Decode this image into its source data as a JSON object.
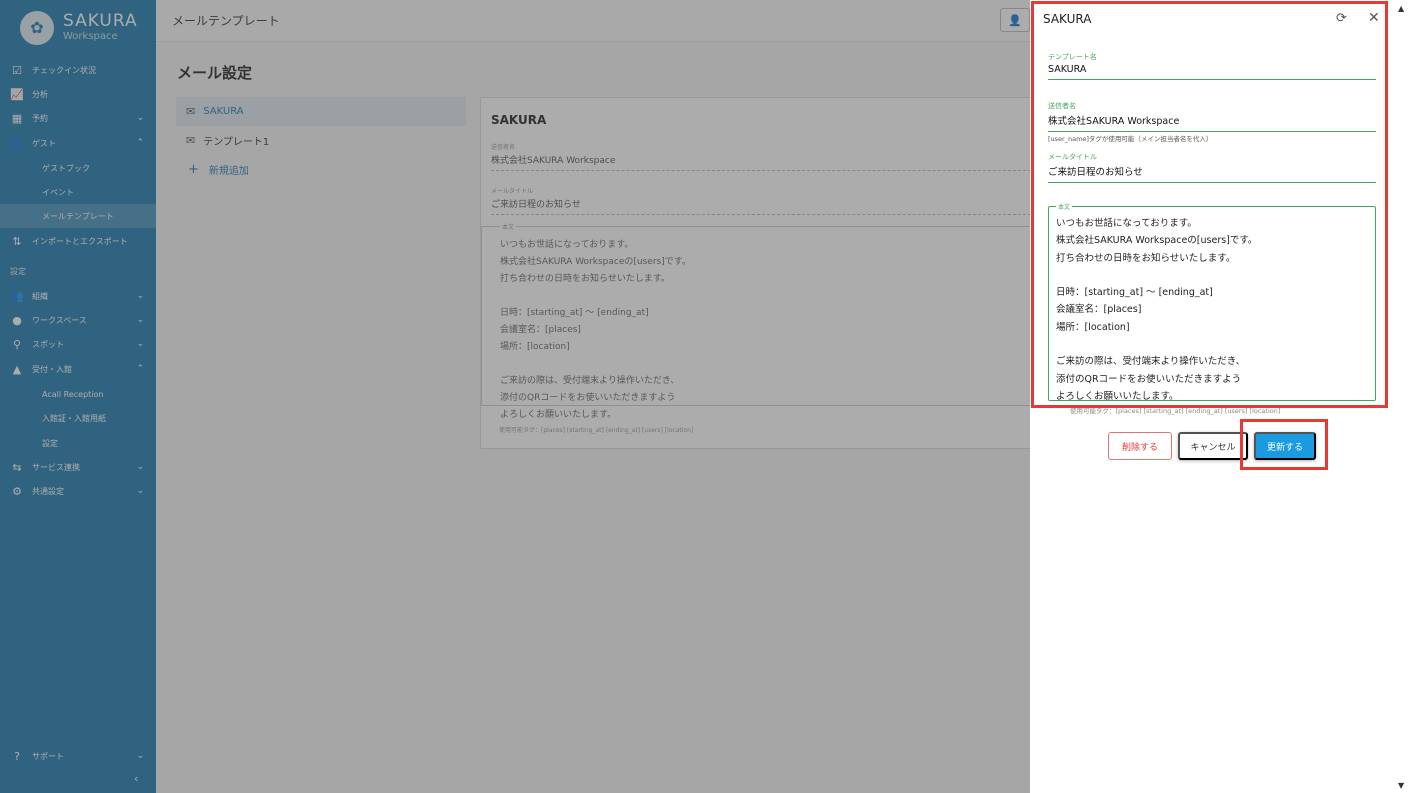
{
  "sidebar": {
    "brand": "SAKURA",
    "brand_sub": "Workspace",
    "items": [
      {
        "label": "チェックイン状況",
        "icon": "checkbox-icon"
      },
      {
        "label": "分析",
        "icon": "chart-line-icon"
      },
      {
        "label": "予約",
        "icon": "calendar-icon"
      },
      {
        "label": "ゲスト",
        "icon": "person-icon"
      },
      {
        "label": "インポートとエクスポート",
        "icon": "import-export-icon"
      },
      {
        "label": "組織",
        "icon": "group-icon"
      },
      {
        "label": "ワークスペース",
        "icon": "location-pin-icon"
      },
      {
        "label": "スポット",
        "icon": "spot-pin-icon"
      },
      {
        "label": "受付・入館",
        "icon": "reception-icon"
      },
      {
        "label": "サービス連携",
        "icon": "service-icon"
      },
      {
        "label": "共通設定",
        "icon": "gears-icon"
      },
      {
        "label": "サポート",
        "icon": "help-icon"
      }
    ],
    "guest_sub": [
      "ゲストブック",
      "イベント",
      "メールテンプレート"
    ],
    "reception_sub": [
      "Acall Reception",
      "入館証・入館用紙",
      "設定"
    ],
    "section_label": "設定"
  },
  "topbar": {
    "title": "メールテンプレート"
  },
  "main": {
    "page_title": "メール設定",
    "templates": [
      "SAKURA",
      "テンプレート1"
    ],
    "add_label": "新規追加",
    "detail": {
      "title": "SAKURA",
      "sender_label": "送信者名",
      "sender_value": "株式会社SAKURA Workspace",
      "subject_label": "メールタイトル",
      "subject_value": "ご来訪日程のお知らせ",
      "body_label": "本文",
      "body": "いつもお世話になっております。\n株式会社SAKURA Workspaceの[users]です。\n打ち合わせの日時をお知らせいたします。\n\n日時：[starting_at] 〜 [ending_at]\n会議室名：[places]\n場所：[location]\n\nご来訪の際は、受付端末より操作いただき、\n添付のQRコードをお使いいただきますよう\nよろしくお願いいたします。",
      "tags": "使用可能タグ：[places] [starting_at] [ending_at] [users] [location]"
    }
  },
  "drawer": {
    "title": "SAKURA",
    "template_name_label": "テンプレート名",
    "template_name_value": "SAKURA",
    "sender_label": "送信者名",
    "sender_value": "株式会社SAKURA Workspace",
    "sender_helper": "[user_name]タグが使用可能（メイン担当者名を代入）",
    "subject_label": "メールタイトル",
    "subject_value": "ご来訪日程のお知らせ",
    "body_label": "本文",
    "body": "いつもお世話になっております。\n株式会社SAKURA Workspaceの[users]です。\n打ち合わせの日時をお知らせいたします。\n\n日時：[starting_at] 〜 [ending_at]\n会議室名：[places]\n場所：[location]\n\nご来訪の際は、受付端末より操作いただき、\n添付のQRコードをお使いいただきますよう\nよろしくお願いいたします。",
    "tags": "使用可能タグ：[places] [starting_at] [ending_at] [users] [location]",
    "delete_label": "削除する",
    "cancel_label": "キャンセル",
    "update_label": "更新する"
  },
  "colors": {
    "sidebar": "#1d7bb0",
    "accent_green": "#46a55a",
    "primary": "#1a9be0",
    "danger": "#e53935",
    "highlight": "#e53935"
  }
}
